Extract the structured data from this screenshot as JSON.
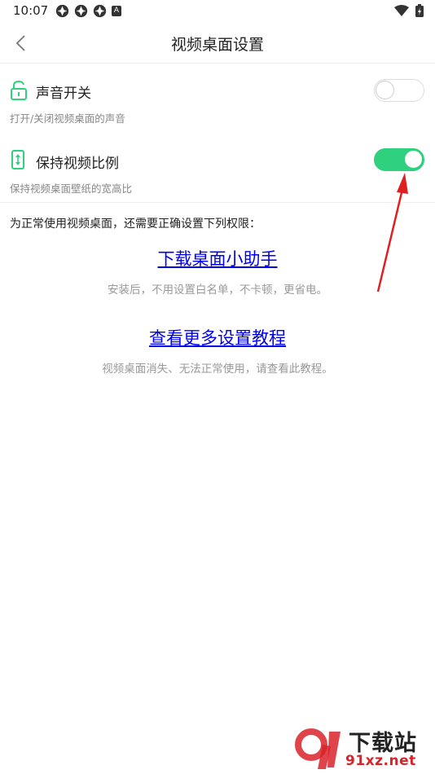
{
  "status_bar": {
    "time": "10:07",
    "notification_icons": [
      "aperture-icon",
      "aperture-icon",
      "aperture-icon",
      "a-badge-icon"
    ],
    "a_badge": "A"
  },
  "header": {
    "title": "视频桌面设置"
  },
  "settings": [
    {
      "title": "声音开关",
      "description": "打开/关闭视频桌面的声音",
      "icon": "unlock-icon",
      "enabled": false
    },
    {
      "title": "保持视频比例",
      "description": "保持视频桌面壁纸的宽高比",
      "icon": "phone-aspect-icon",
      "enabled": true
    }
  ],
  "permission_note": "为正常使用视频桌面，还需要正确设置下列权限：",
  "links": [
    {
      "label": "下载桌面小助手",
      "description": "安装后，不用设置白名单，不卡顿，更省电。"
    },
    {
      "label": "查看更多设置教程",
      "description": "视频桌面消失、无法正常使用，请查看此教程。"
    }
  ],
  "watermark": {
    "line1": "下载站",
    "line2": "91xz.net"
  },
  "colors": {
    "accent": "#2fd07e",
    "link": "#0000ee",
    "arrow": "#e02020"
  }
}
